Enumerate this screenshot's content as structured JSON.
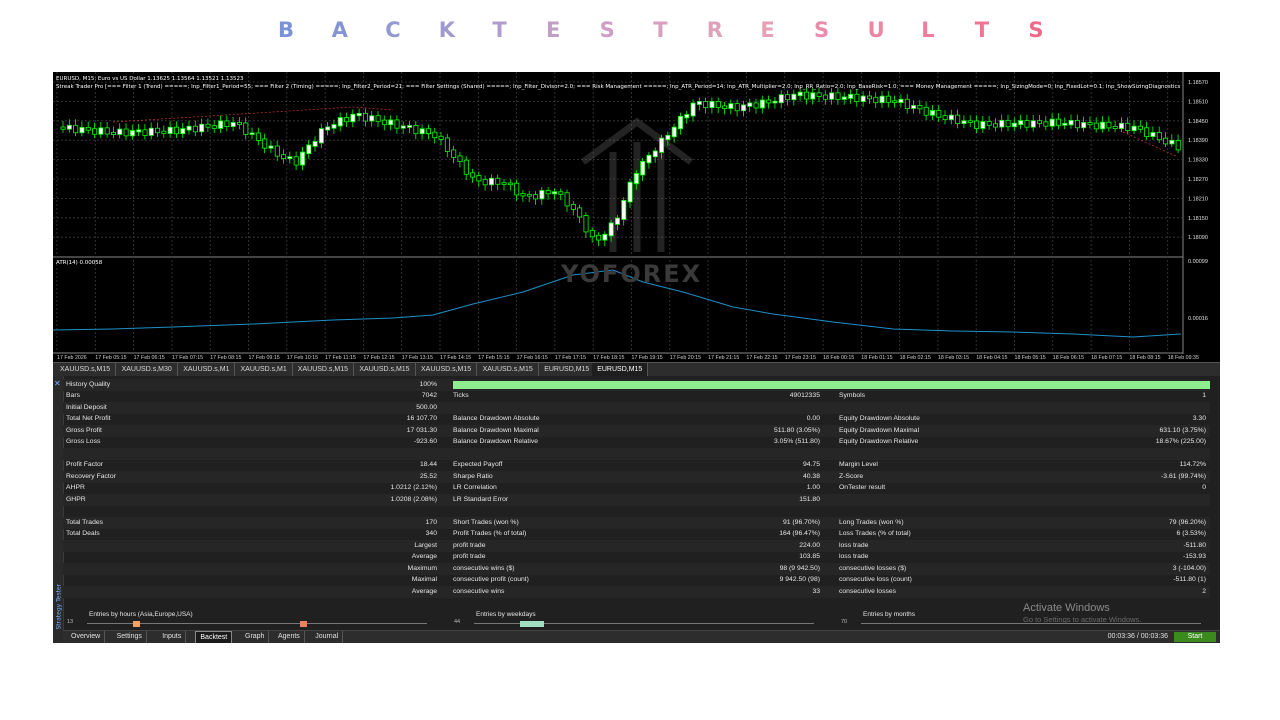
{
  "banner": {
    "letters": [
      "B",
      "A",
      "C",
      "K",
      "T",
      "E",
      "S",
      "T",
      "R",
      "E",
      "S",
      "U",
      "L",
      "T",
      "S"
    ],
    "colors": [
      "#7b93d6",
      "#8595d4",
      "#9399d3",
      "#a09ad0",
      "#b09ccf",
      "#c09ec6",
      "#cf9ec6",
      "#d89fbf",
      "#e0a1bb",
      "#e6a1b6",
      "#e98ca9",
      "#ec86a4",
      "#ee7d9b",
      "#ef7493",
      "#f06a89"
    ]
  },
  "chart": {
    "symbol_line": "EURUSD, M15:  Euro vs US Dollar  1.13625  1.13564  1.13521  1.13523",
    "params_line": "Streak Trader Pro [=== Filter 1 (Trend) =====; Inp_Filter1_Period=55; === Filter 2 (Timing) =====; Inp_Filter2_Period=21; === Filter Settings (Shared) =====; Inp_Filter_Divisor=2.0; === Risk Management =====; Inp_ATR_Period=14; Inp_ATR_Multiplier=2.0; Inp_RR_Ratio=2.0; Inp_BaseRisk=1.0; === Money Management =====; Inp_SizingMode=0; Inp_FixedLot=0.1; Inp_ShowSizingDiagnostics=true; === Streak Progression ===",
    "indicator_label": "ATR(14) 0.00058",
    "watermark": "YOFOREX",
    "price_levels": [
      "1.18570",
      "1.18510",
      "1.18450",
      "1.18390",
      "1.18330",
      "1.18270",
      "1.18210",
      "1.18150",
      "1.18090"
    ],
    "atr_levels": [
      "0.00099",
      "0.00016"
    ],
    "time_labels": [
      "17 Feb 2026",
      "17 Feb 05:15",
      "17 Feb 06:15",
      "17 Feb 07:15",
      "17 Feb 08:15",
      "17 Feb 09:15",
      "17 Feb 10:15",
      "17 Feb 11:15",
      "17 Feb 12:15",
      "17 Feb 13:15",
      "17 Feb 14:15",
      "17 Feb 15:15",
      "17 Feb 16:15",
      "17 Feb 17:15",
      "17 Feb 18:15",
      "17 Feb 19:15",
      "17 Feb 20:15",
      "17 Feb 21:15",
      "17 Feb 22:15",
      "17 Feb 23:15",
      "18 Feb 00:15",
      "18 Feb 01:15",
      "18 Feb 02:15",
      "18 Feb 03:15",
      "18 Feb 04:15",
      "18 Feb 05:15",
      "18 Feb 06:15",
      "18 Feb 07:15",
      "18 Feb 08:15",
      "18 Feb 09:35"
    ]
  },
  "symbol_tabs": [
    "XAUUSD.s,M15",
    "XAUUSD.s,M30",
    "XAUUSD.s,M1",
    "XAUUSD.s,M1",
    "XAUUSD.s,M15",
    "XAUUSD.s,M15",
    "XAUUSD.s,M15",
    "XAUUSD.s,M15",
    "EURUSD,M15",
    "EURUSD,M15"
  ],
  "active_symbol_tab": 9,
  "report": {
    "history_quality": {
      "label": "History Quality",
      "value": "100%",
      "bar_fraction": 1.0,
      "bar_color": "#90ee90"
    },
    "rows": [
      [
        "Bars",
        "7042",
        "Ticks",
        "49012335",
        "Symbols",
        "1"
      ],
      [
        "Initial Deposit",
        "500.00",
        "",
        "",
        "",
        ""
      ],
      [
        "Total Net Profit",
        "16 107.70",
        "Balance Drawdown Absolute",
        "0.00",
        "Equity Drawdown Absolute",
        "3.30"
      ],
      [
        "Gross Profit",
        "17 031.30",
        "Balance Drawdown Maximal",
        "511.80 (3.05%)",
        "Equity Drawdown Maximal",
        "631.10 (3.75%)"
      ],
      [
        "Gross Loss",
        "-923.60",
        "Balance Drawdown Relative",
        "3.05% (511.80)",
        "Equity Drawdown Relative",
        "18.67% (225.00)"
      ],
      [
        "",
        "",
        "",
        "",
        "",
        ""
      ],
      [
        "Profit Factor",
        "18.44",
        "Expected Payoff",
        "94.75",
        "Margin Level",
        "114.72%"
      ],
      [
        "Recovery Factor",
        "25.52",
        "Sharpe Ratio",
        "40.38",
        "Z-Score",
        "-3.61 (99.74%)"
      ],
      [
        "AHPR",
        "1.0212 (2.12%)",
        "LR Correlation",
        "1.00",
        "OnTester result",
        "0"
      ],
      [
        "GHPR",
        "1.0208 (2.08%)",
        "LR Standard Error",
        "151.80",
        "",
        ""
      ],
      [
        "",
        "",
        "",
        "",
        "",
        ""
      ],
      [
        "Total Trades",
        "170",
        "Short Trades (won %)",
        "91 (96.70%)",
        "Long Trades (won %)",
        "79 (96.20%)"
      ],
      [
        "Total Deals",
        "340",
        "Profit Trades (% of total)",
        "164 (96.47%)",
        "Loss Trades (% of total)",
        "6 (3.53%)"
      ],
      [
        "",
        "Largest",
        "profit trade",
        "224.00",
        "loss trade",
        "-511.80"
      ],
      [
        "",
        "Average",
        "profit trade",
        "103.85",
        "loss trade",
        "-153.93"
      ],
      [
        "",
        "Maximum",
        "consecutive wins ($)",
        "98 (9 942.50)",
        "consecutive losses ($)",
        "3 (-104.00)"
      ],
      [
        "",
        "Maximal",
        "consecutive profit (count)",
        "9 942.50 (98)",
        "consecutive loss (count)",
        "-511.80 (1)"
      ],
      [
        "",
        "Average",
        "consecutive wins",
        "33",
        "consecutive losses",
        "2"
      ]
    ],
    "entries": [
      {
        "title": "Entries by hours (Asia,Europe,USA)",
        "count": "13"
      },
      {
        "title": "Entries by weekdays",
        "count": "44"
      },
      {
        "title": "Entries by months",
        "count": "70"
      }
    ]
  },
  "bottom_tabs": [
    "Overview",
    "Settings",
    "Inputs",
    "Backtest",
    "Graph",
    "Agents",
    "Journal"
  ],
  "active_bottom_tab": 3,
  "panel_label": "Strategy Tester",
  "timer": "00:03:36 / 00:03:36",
  "start_button": "Start",
  "activate": {
    "line1": "Activate Windows",
    "line2": "Go to Settings to activate Windows."
  },
  "colors": {
    "bull_candle": "#ffffff",
    "bear_candle": "#00ff00",
    "atr_line": "#1e90c8",
    "grid": "#404040",
    "start": "#3a8a1e"
  }
}
